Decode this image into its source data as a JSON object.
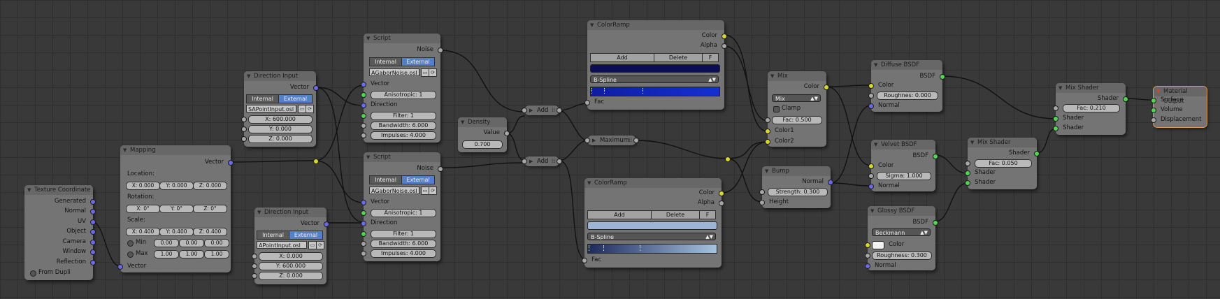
{
  "nodes": {
    "texcoord": {
      "title": "Texture Coordinate",
      "outputs": [
        "Generated",
        "Normal",
        "UV",
        "Object",
        "Camera",
        "Window",
        "Reflection"
      ],
      "from_dupli": "From Dupli"
    },
    "mapping": {
      "title": "Mapping",
      "out_vector": "Vector",
      "location_label": "Location:",
      "location": [
        "X: 0.000",
        "Y: 0.000",
        "Z: 0.000"
      ],
      "rotation_label": "Rotation:",
      "rotation": [
        "X: 0°",
        "Y: 0°",
        "Z: 0°"
      ],
      "scale_label": "Scale:",
      "scale": [
        "X: 0.400",
        "Y: 0.400",
        "Z: 0.400"
      ],
      "min_label": "Min",
      "min": [
        "0.00",
        "0.00",
        "0.00"
      ],
      "max_label": "Max",
      "max": [
        "1.00",
        "1.00",
        "1.00"
      ],
      "in_vector": "Vector"
    },
    "dir1": {
      "title": "Direction Input",
      "out_vector": "Vector",
      "mode_internal": "Internal",
      "mode_external": "External",
      "file": "SAPointInput.osl",
      "x": "X: 600.000",
      "y": "Y: 0.000",
      "z": "Z: 0.000"
    },
    "dir2": {
      "title": "Direction Input",
      "out_vector": "Vector",
      "mode_internal": "Internal",
      "mode_external": "External",
      "file": "APointInput.osl",
      "x": "X: 0.000",
      "y": "Y: 600.000",
      "z": "Z: 0.000"
    },
    "script1": {
      "title": "Script",
      "out_noise": "Noise",
      "mode_internal": "Internal",
      "mode_external": "External",
      "file": "AGaborNoise.osl",
      "in_vector": "Vector",
      "anisotropic": "Anisotropic: 1",
      "in_direction": "Direction",
      "filter": "Filter: 1",
      "bandwidth": "Bandwidth: 6.000",
      "impulses": "Impulses: 4.000"
    },
    "script2": {
      "title": "Script",
      "out_noise": "Noise",
      "mode_internal": "Internal",
      "mode_external": "External",
      "file": "AGaborNoise.osl",
      "in_vector": "Vector",
      "anisotropic": "Anisotropic: 1",
      "in_direction": "Direction",
      "filter": "Filter: 1",
      "bandwidth": "Bandwidth: 6.000",
      "impulses": "Impulses: 4.000"
    },
    "density": {
      "title": "Density",
      "out_value": "Value",
      "value": "0.700"
    },
    "add1": {
      "title": "Add"
    },
    "add2": {
      "title": "Add"
    },
    "maximum": {
      "title": "Maximum"
    },
    "ramp1": {
      "title": "ColorRamp",
      "out_color": "Color",
      "out_alpha": "Alpha",
      "add": "Add",
      "delete": "Delete",
      "f": "F",
      "interp": "B-Spline",
      "in_fac": "Fac",
      "color": "#0a0f55",
      "ramp_from": "#0e1ea0",
      "ramp_to": "#1530d0"
    },
    "ramp2": {
      "title": "ColorRamp",
      "out_color": "Color",
      "out_alpha": "Alpha",
      "add": "Add",
      "delete": "Delete",
      "f": "F",
      "interp": "B-Spline",
      "in_fac": "Fac",
      "color": "#9cb4d6",
      "ramp_from": "#1d2a5c",
      "ramp_to": "#a6c3e0"
    },
    "mix": {
      "title": "Mix",
      "out_color": "Color",
      "blend": "Mix",
      "clamp": "Clamp",
      "fac": "Fac: 0.500",
      "in_color1": "Color1",
      "in_color2": "Color2"
    },
    "bump": {
      "title": "Bump",
      "out_normal": "Normal",
      "strength": "Strength: 0.300",
      "in_height": "Height"
    },
    "diffuse": {
      "title": "Diffuse BSDF",
      "out_bsdf": "BSDF",
      "in_color": "Color",
      "roughness": "Roughnes: 0.000",
      "in_normal": "Normal"
    },
    "velvet": {
      "title": "Velvet BSDF",
      "out_bsdf": "BSDF",
      "in_color": "Color",
      "sigma": "Sigma: 1.000",
      "in_normal": "Normal"
    },
    "glossy": {
      "title": "Glossy BSDF",
      "out_bsdf": "BSDF",
      "distribution": "Beckmann",
      "in_color": "Color",
      "roughness": "Roughness: 0.300",
      "in_normal": "Normal",
      "color": "#f2f2f2"
    },
    "mixshader2": {
      "title": "Mix Shader",
      "out_shader": "Shader",
      "fac": "Fac: 0.050",
      "in_shader1": "Shader",
      "in_shader2": "Shader"
    },
    "mixshader1": {
      "title": "Mix Shader",
      "out_shader": "Shader",
      "fac": "Fac: 0.210",
      "in_shader1": "Shader",
      "in_shader2": "Shader"
    },
    "output": {
      "title": "Material Output",
      "in_surface": "Surface",
      "in_volume": "Volume",
      "in_displacement": "Displacement"
    }
  },
  "colors": {
    "background": "#393939",
    "wire": "#111111",
    "node_body": "#747474",
    "node_header": "#676767",
    "selected_toggle": "#5480c8",
    "socket_vector": "#6a6ae8",
    "socket_color": "#d8d82e",
    "socket_float": "#a6a6a6",
    "socket_shader": "#54d454",
    "active_outline": "#e09a52"
  }
}
